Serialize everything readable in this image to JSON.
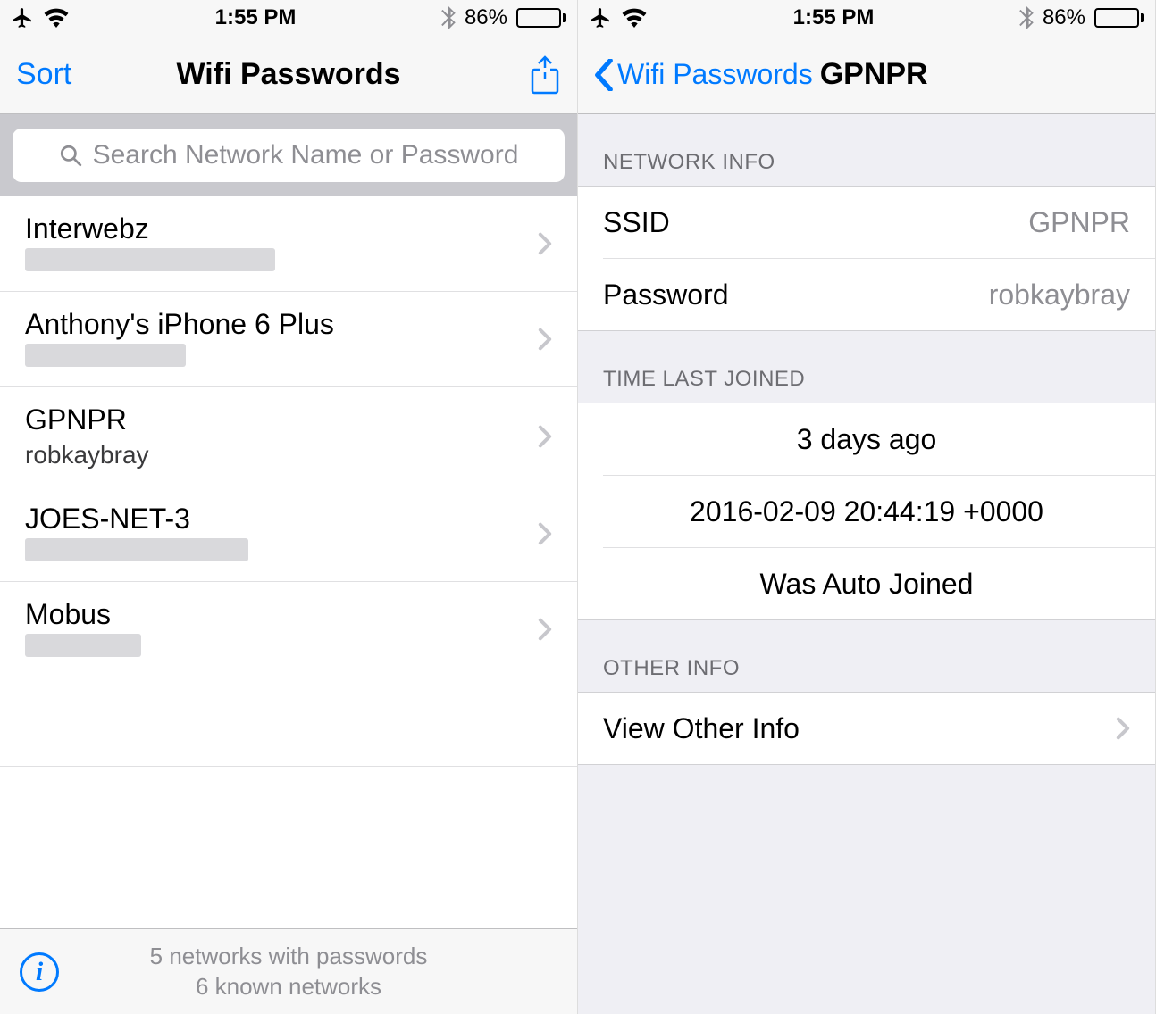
{
  "status": {
    "time": "1:55 PM",
    "battery_pct": "86%",
    "battery_level": 86
  },
  "left": {
    "nav": {
      "sort_label": "Sort",
      "title": "Wifi Passwords"
    },
    "search_placeholder": "Search Network Name or Password",
    "networks": [
      {
        "name": "Interwebz",
        "password": "",
        "blurred": true,
        "blur_w": 280
      },
      {
        "name": "Anthony's iPhone 6 Plus",
        "password": "",
        "blurred": true,
        "blur_w": 180
      },
      {
        "name": "GPNPR",
        "password": "robkaybray",
        "blurred": false,
        "blur_w": 0
      },
      {
        "name": "JOES-NET-3",
        "password": "",
        "blurred": true,
        "blur_w": 250
      },
      {
        "name": "Mobus",
        "password": "",
        "blurred": true,
        "blur_w": 130
      }
    ],
    "footer": {
      "line1": "5 networks with passwords",
      "line2": "6 known networks"
    }
  },
  "right": {
    "nav": {
      "back_label": "Wifi Passwords",
      "title": "GPNPR"
    },
    "sections": {
      "network_info_header": "NETWORK INFO",
      "ssid_label": "SSID",
      "ssid_value": "GPNPR",
      "password_label": "Password",
      "password_value": "robkaybray",
      "time_header": "TIME LAST JOINED",
      "time_relative": "3 days ago",
      "time_absolute": "2016-02-09 20:44:19 +0000",
      "time_auto": "Was Auto Joined",
      "other_header": "OTHER INFO",
      "other_label": "View Other Info"
    }
  }
}
